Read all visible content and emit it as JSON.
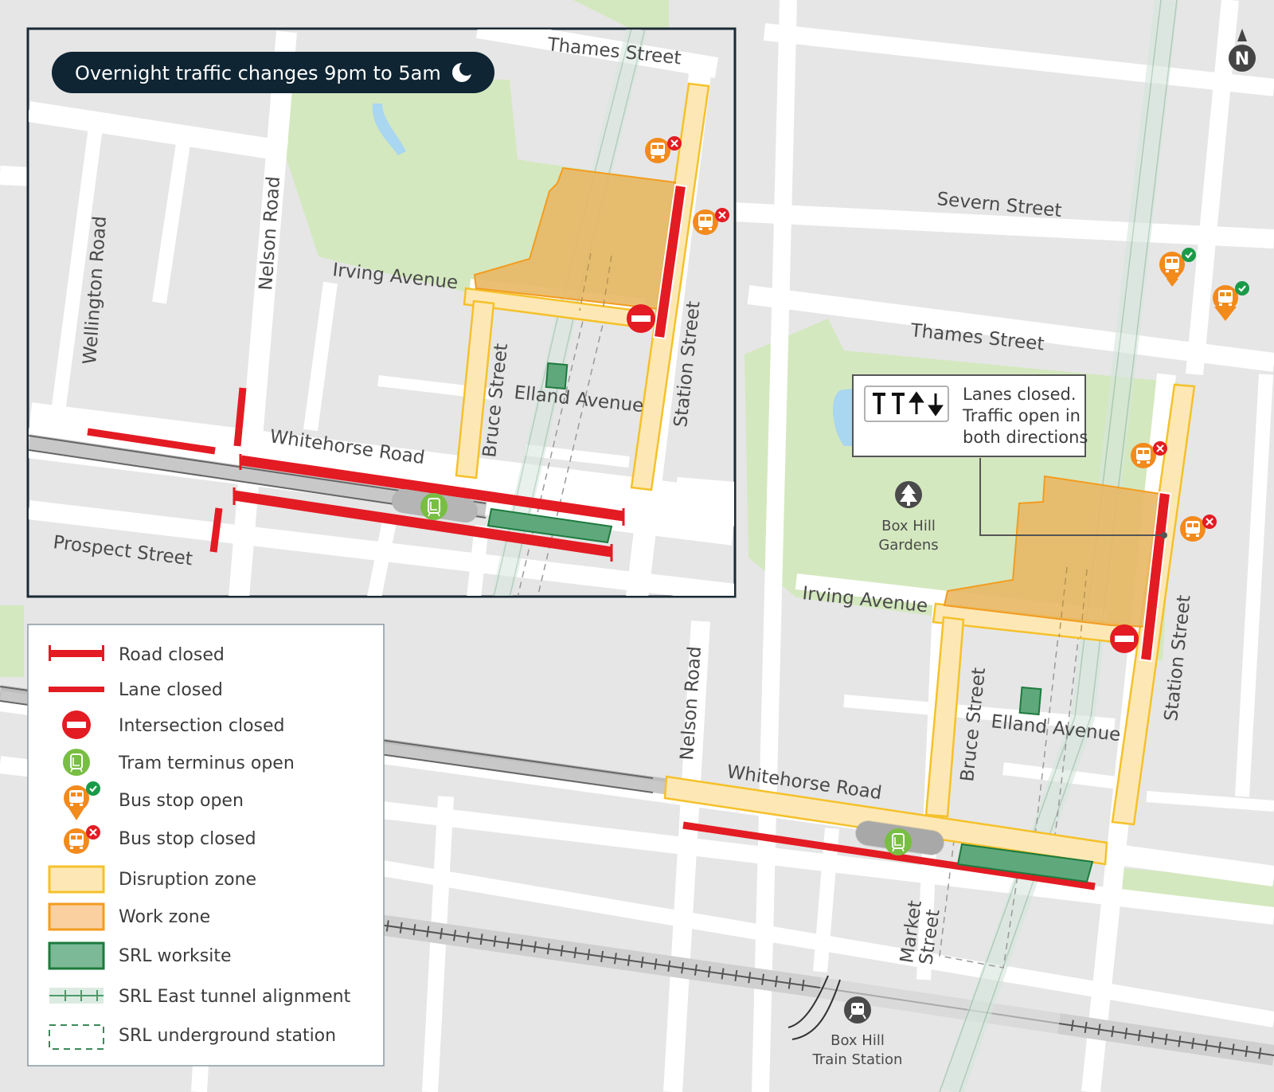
{
  "banner": {
    "text": "Overnight traffic changes 9pm to 5am",
    "icon": "moon-icon"
  },
  "compass": {
    "label": "N",
    "icon": "north-arrow-icon"
  },
  "colors": {
    "road_closed": "#e31b23",
    "disruption_fill": "#fde8b5",
    "disruption_stroke": "#f5c12b",
    "work_fill": "#e8b865",
    "work_stroke": "#f39c20",
    "srl_worksite_fill": "#5fa87c",
    "srl_worksite_stroke": "#1d7a3e",
    "tram": "#78be43",
    "bus": "#f28a1c",
    "park": "#d4e8bf",
    "water": "#a9d6f0",
    "banner_bg": "#0f2533"
  },
  "inset_map": {
    "streets": {
      "thames": "Thames Street",
      "nelson": "Nelson Road",
      "wellington": "Wellington Road",
      "irving": "Irving Avenue",
      "bruce": "Bruce Street",
      "elland": "Elland Avenue",
      "station": "Station Street",
      "whitehorse": "Whitehorse Road",
      "prospect": "Prospect Street"
    }
  },
  "main_map": {
    "streets": {
      "severn": "Severn Street",
      "thames": "Thames Street",
      "irving": "Irving Avenue",
      "nelson": "Nelson Road",
      "bruce": "Bruce Street",
      "elland": "Elland Avenue",
      "station": "Station Street",
      "whitehorse": "Whitehorse Road",
      "market_line1": "Market",
      "market_line2": "Street"
    },
    "places": {
      "gardens_line1": "Box Hill",
      "gardens_line2": "Gardens",
      "train_line1": "Box Hill",
      "train_line2": "Train Station"
    },
    "callout": {
      "line1": "Lanes closed.",
      "line2": "Traffic open in",
      "line3": "both directions",
      "icon": "lanes-closed-two-way-icon"
    }
  },
  "legend": {
    "items": [
      {
        "label": "Road closed",
        "icon": "road-closed-icon"
      },
      {
        "label": "Lane closed",
        "icon": "lane-closed-icon"
      },
      {
        "label": "Intersection closed",
        "icon": "intersection-closed-icon"
      },
      {
        "label": "Tram terminus open",
        "icon": "tram-icon"
      },
      {
        "label": "Bus stop open",
        "icon": "bus-stop-open-icon"
      },
      {
        "label": "Bus stop closed",
        "icon": "bus-stop-closed-icon"
      },
      {
        "label": "Disruption zone",
        "icon": "disruption-zone-swatch"
      },
      {
        "label": "Work zone",
        "icon": "work-zone-swatch"
      },
      {
        "label": "SRL worksite",
        "icon": "srl-worksite-swatch"
      },
      {
        "label": "SRL East tunnel alignment",
        "icon": "tunnel-alignment-icon"
      },
      {
        "label": "SRL underground station",
        "icon": "underground-station-icon"
      }
    ]
  }
}
